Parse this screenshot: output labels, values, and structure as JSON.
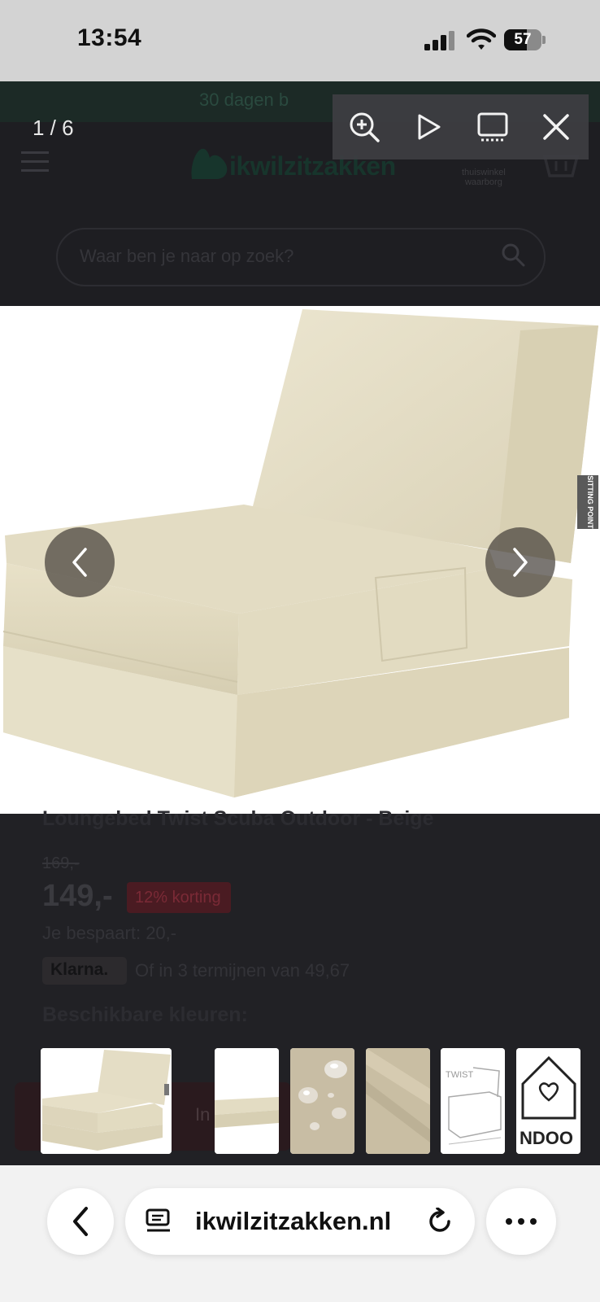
{
  "status_bar": {
    "time": "13:54",
    "battery_level": "57",
    "signal_icon": "cellular-signal-icon",
    "wifi_icon": "wifi-icon"
  },
  "page": {
    "promo_text": "30 dagen b",
    "logo_text": "ikwilzitzakken",
    "trust_badge": [
      "thuiswinkel",
      "waarborg"
    ],
    "search_placeholder": "Waar ben je naar op zoek?",
    "product_title": "Loungebed Twist Scuba Outdoor - Beige",
    "old_price": "169,-",
    "price": "149,-",
    "discount_badge": "12% korting",
    "savings": "Je bespaart: 20,-",
    "klarna_label": "Klarna.",
    "installments": "Of in 3 termijnen van 49,67",
    "colors_label": "Beschikbare kleuren:",
    "add_to_cart_label": "In"
  },
  "lightbox": {
    "counter": "1 / 6",
    "tools": [
      "zoom-in-icon",
      "play-icon",
      "fullscreen-icon",
      "close-icon"
    ],
    "brand_tag": "SITTING POINT",
    "thumbnail_labels": [
      "TWIST",
      "NDOO"
    ]
  },
  "browser": {
    "url": "ikwilzitzakken.nl"
  },
  "colors": {
    "accent_green": "#1c2a26",
    "discount_red": "#4a1b22",
    "product_beige": "#e6dfc7"
  }
}
